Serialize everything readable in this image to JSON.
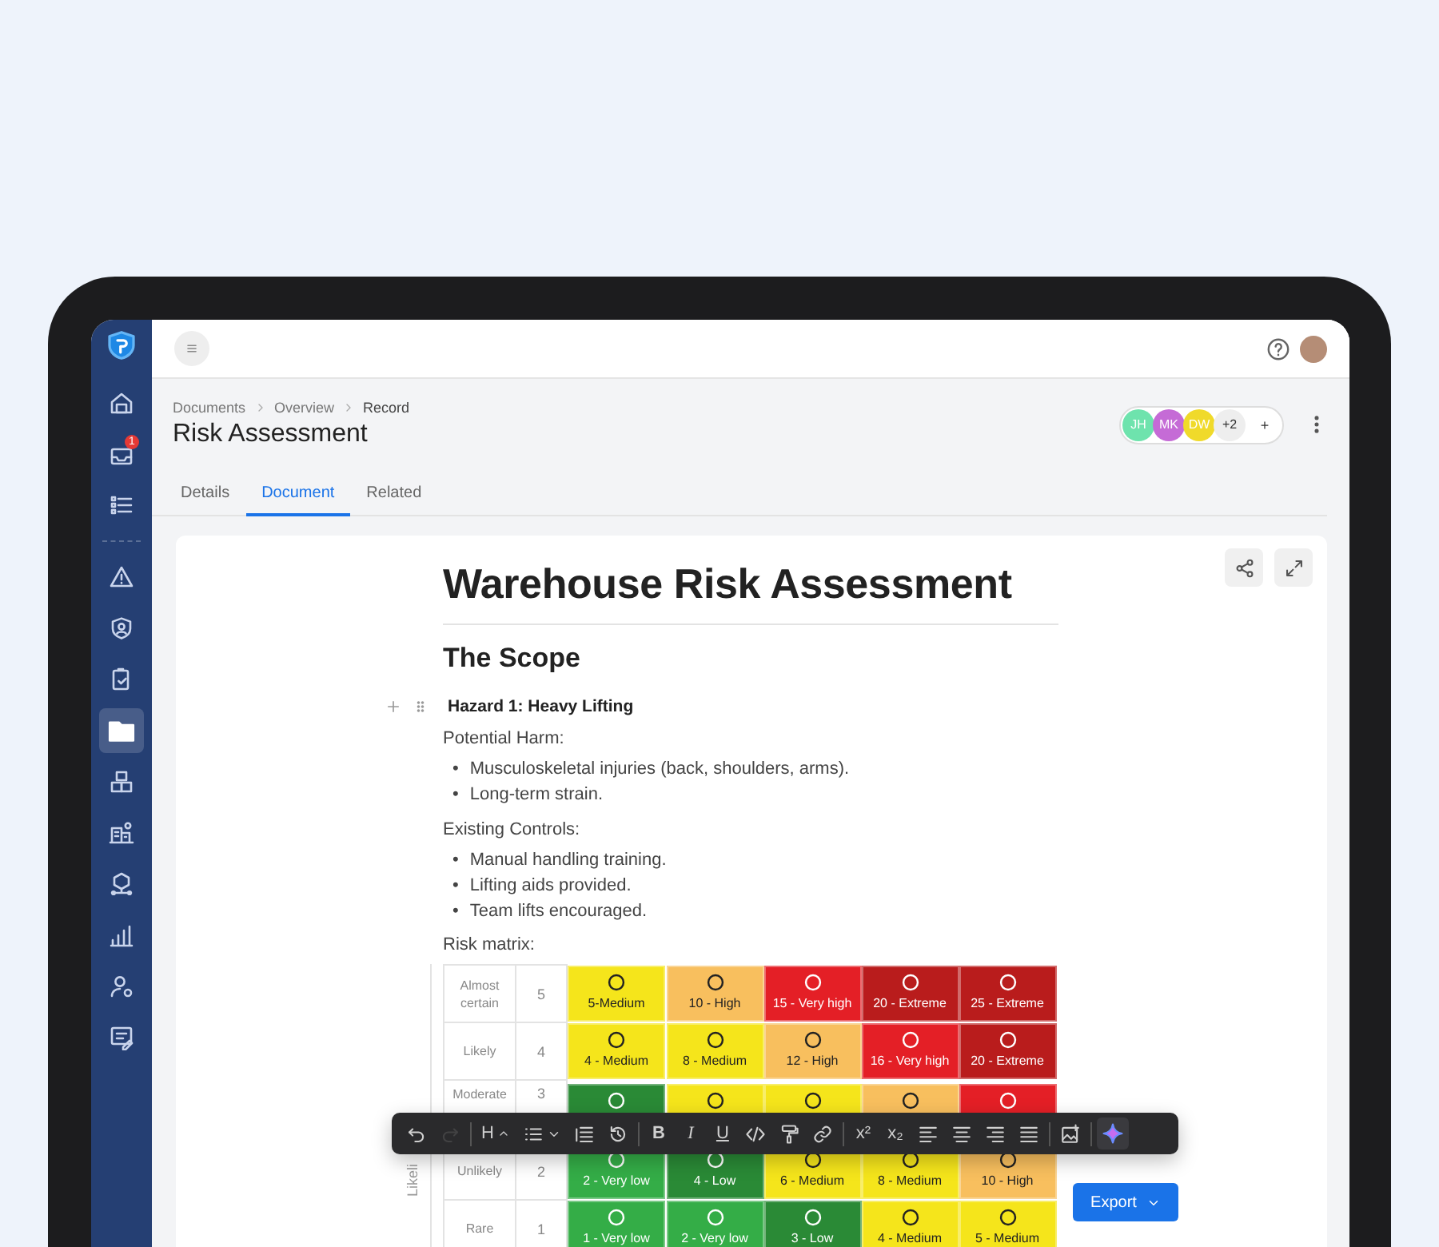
{
  "sidebar": {
    "groups": [
      [
        {
          "selected": false
        },
        {
          "selected": false,
          "badge": "1"
        },
        {
          "selected": false
        }
      ],
      [
        {
          "selected": false
        },
        {
          "selected": false
        },
        {
          "selected": false
        },
        {
          "selected": true
        },
        {
          "selected": false
        },
        {
          "selected": false
        },
        {
          "selected": false
        },
        {
          "selected": false
        },
        {
          "selected": false
        },
        {
          "selected": false
        }
      ]
    ]
  },
  "breadcrumb": [
    "Documents",
    "Overview",
    "Record"
  ],
  "page_title": "Risk Assessment",
  "collaborators": [
    {
      "initials": "JH",
      "color": "#6ee3ad"
    },
    {
      "initials": "MK",
      "color": "#c56bd6"
    },
    {
      "initials": "DW",
      "color": "#f0da2a"
    }
  ],
  "collaborators_more": "+2",
  "add_collaborator": "+",
  "tabs": [
    {
      "label": "Details",
      "selected": false
    },
    {
      "label": "Document",
      "selected": true
    },
    {
      "label": "Related",
      "selected": false
    }
  ],
  "document": {
    "title": "Warehouse Risk Assessment",
    "heading": "The Scope",
    "hazard": "Hazard 1: Heavy Lifting",
    "lists": [
      {
        "label": "Potential Harm:",
        "marker": "•",
        "items": [
          "Musculoskeletal injuries (back, shoulders, arms).",
          "Long-term strain."
        ]
      },
      {
        "label": "Existing Controls:",
        "marker": "•",
        "items": [
          "Manual handling training.",
          "Lifting aids provided.",
          "Team lifts encouraged."
        ]
      }
    ],
    "matrix_caption": "Risk matrix:"
  },
  "risk_matrix": {
    "axis_label": "Likeli",
    "rows": [
      {
        "label": "Almost certain",
        "score": "5",
        "cells": [
          {
            "text": "5-Medium",
            "color": "#f5e51b"
          },
          {
            "text": "10 - High",
            "color": "#f8bf5e"
          },
          {
            "text": "15 - Very high",
            "color": "#e41f26"
          },
          {
            "text": "20 - Extreme",
            "color": "#b91c1c"
          },
          {
            "text": "25 - Extreme",
            "color": "#b91c1c"
          }
        ]
      },
      {
        "label": "Likely",
        "score": "4",
        "cells": [
          {
            "text": "4 - Medium",
            "color": "#f5e51b"
          },
          {
            "text": "8 - Medium",
            "color": "#f5e51b"
          },
          {
            "text": "12 - High",
            "color": "#f8bf5e"
          },
          {
            "text": "16 - Very high",
            "color": "#e41f26"
          },
          {
            "text": "20 - Extreme",
            "color": "#b91c1c"
          }
        ]
      },
      {
        "label": "Moderate",
        "score": "3",
        "cells": [
          {
            "color": "#2a8a36"
          },
          {
            "color": "#f5e51b"
          },
          {
            "color": "#f5e51b"
          },
          {
            "color": "#f8bf5e"
          },
          {
            "color": "#e41f26"
          }
        ]
      },
      {
        "label": "Unlikely",
        "score": "2",
        "cells": [
          {
            "text": "2 - Very low",
            "color": "#34ad47"
          },
          {
            "text": "4 - Low",
            "color": "#2a8a36"
          },
          {
            "text": "6 - Medium",
            "color": "#f5e51b"
          },
          {
            "text": "8 - Medium",
            "color": "#f5e51b"
          },
          {
            "text": "10 - High",
            "color": "#f8bf5e"
          }
        ]
      },
      {
        "label": "Rare",
        "score": "1",
        "cells": [
          {
            "text": "1 - Very low",
            "color": "#34ad47"
          },
          {
            "text": "2 - Very low",
            "color": "#34ad47"
          },
          {
            "text": "3 - Low",
            "color": "#2a8a36"
          },
          {
            "text": "4 - Medium",
            "color": "#f5e51b"
          },
          {
            "text": "5 - Medium",
            "color": "#f5e51b"
          }
        ]
      }
    ]
  },
  "toolbar": {
    "groups": [
      [
        {
          "kind": "undo",
          "disabled": false
        },
        {
          "kind": "redo",
          "disabled": true
        }
      ],
      [
        {
          "kind": "heading",
          "label": "H",
          "disabled": false
        },
        {
          "kind": "list",
          "disabled": false
        },
        {
          "kind": "indent",
          "disabled": false
        },
        {
          "kind": "history",
          "disabled": false
        }
      ],
      [
        {
          "kind": "bold",
          "label": "B",
          "disabled": false
        },
        {
          "kind": "italic",
          "label": "I",
          "disabled": false
        },
        {
          "kind": "underline",
          "label": "U",
          "disabled": false
        },
        {
          "kind": "code",
          "disabled": false
        },
        {
          "kind": "paint",
          "disabled": false
        },
        {
          "kind": "link",
          "disabled": false
        }
      ],
      [
        {
          "kind": "superscript",
          "label": "x²",
          "disabled": false
        },
        {
          "kind": "subscript",
          "label": "x₂",
          "disabled": false
        },
        {
          "kind": "align-left",
          "disabled": false
        },
        {
          "kind": "align-center",
          "disabled": false
        },
        {
          "kind": "align-right",
          "disabled": false
        },
        {
          "kind": "justify",
          "disabled": false
        }
      ],
      [
        {
          "kind": "image",
          "disabled": false
        }
      ],
      [
        {
          "kind": "ai",
          "disabled": false
        }
      ]
    ]
  },
  "export_button": "Export"
}
